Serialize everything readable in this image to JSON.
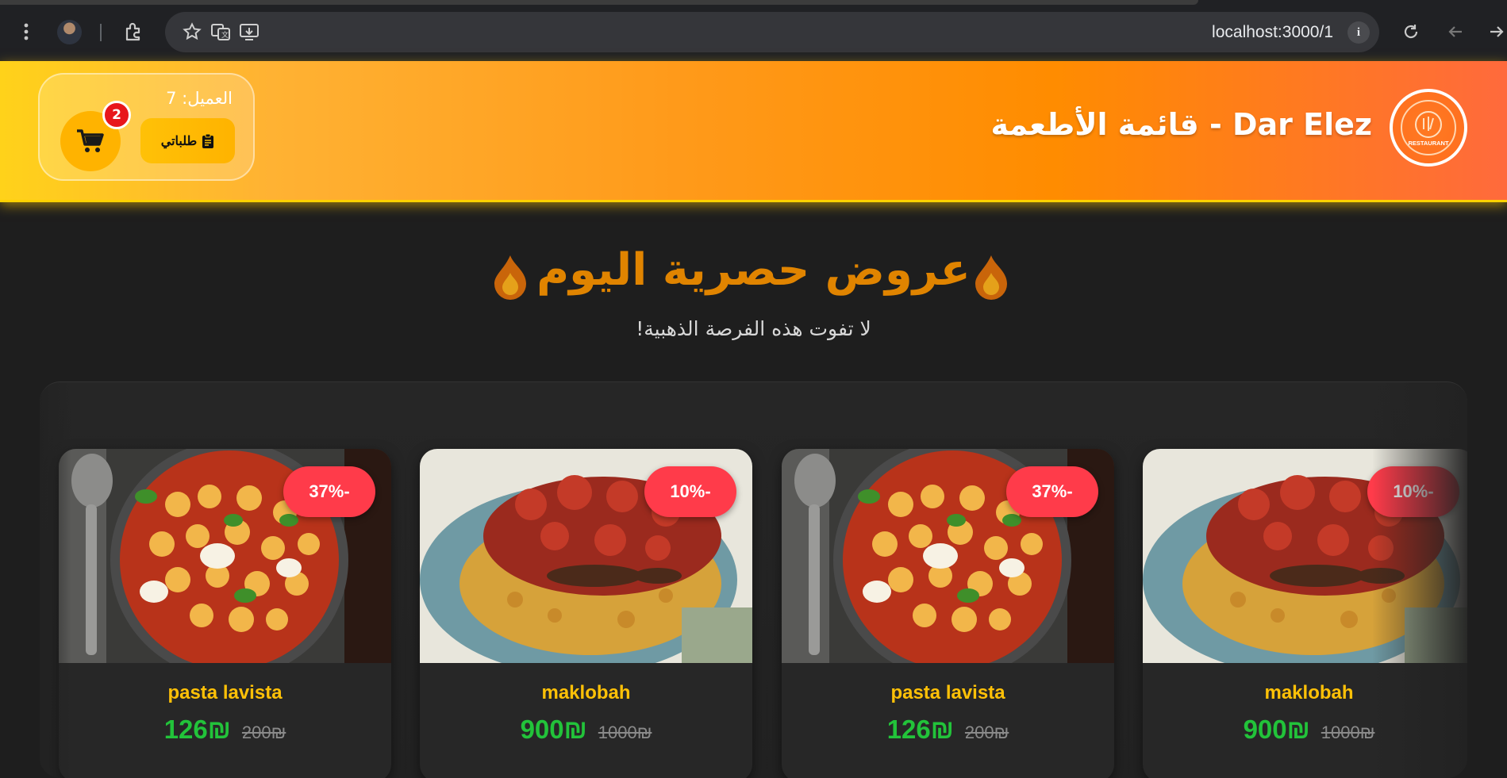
{
  "browser": {
    "url": "localhost:3000/1",
    "info_label": "i"
  },
  "header": {
    "title": "Dar Elez - قائمة الأطعمة",
    "logo_text": "RESTAURANT",
    "client_label": "العميل: 7",
    "orders_label": "طلباتي",
    "cart_count": "2",
    "colors": {
      "gradient_start": "#ffd21a",
      "gradient_end": "#ff6a3c",
      "accent": "#ffb300"
    }
  },
  "offers": {
    "title": "عروض حصرية اليوم",
    "subtitle": "لا تفوت هذه الفرصة الذهبية!",
    "currency": "₪",
    "items": [
      {
        "name": "pasta lavista",
        "price": "126₪",
        "old_price": "200₪",
        "discount": "37%-",
        "dish": "pasta"
      },
      {
        "name": "maklobah",
        "price": "900₪",
        "old_price": "1000₪",
        "discount": "10%-",
        "dish": "maklobah"
      },
      {
        "name": "pasta lavista",
        "price": "126₪",
        "old_price": "200₪",
        "discount": "37%-",
        "dish": "pasta"
      },
      {
        "name": "maklobah",
        "price": "900₪",
        "old_price": "1000₪",
        "discount": "10%-",
        "dish": "maklobah"
      }
    ]
  }
}
